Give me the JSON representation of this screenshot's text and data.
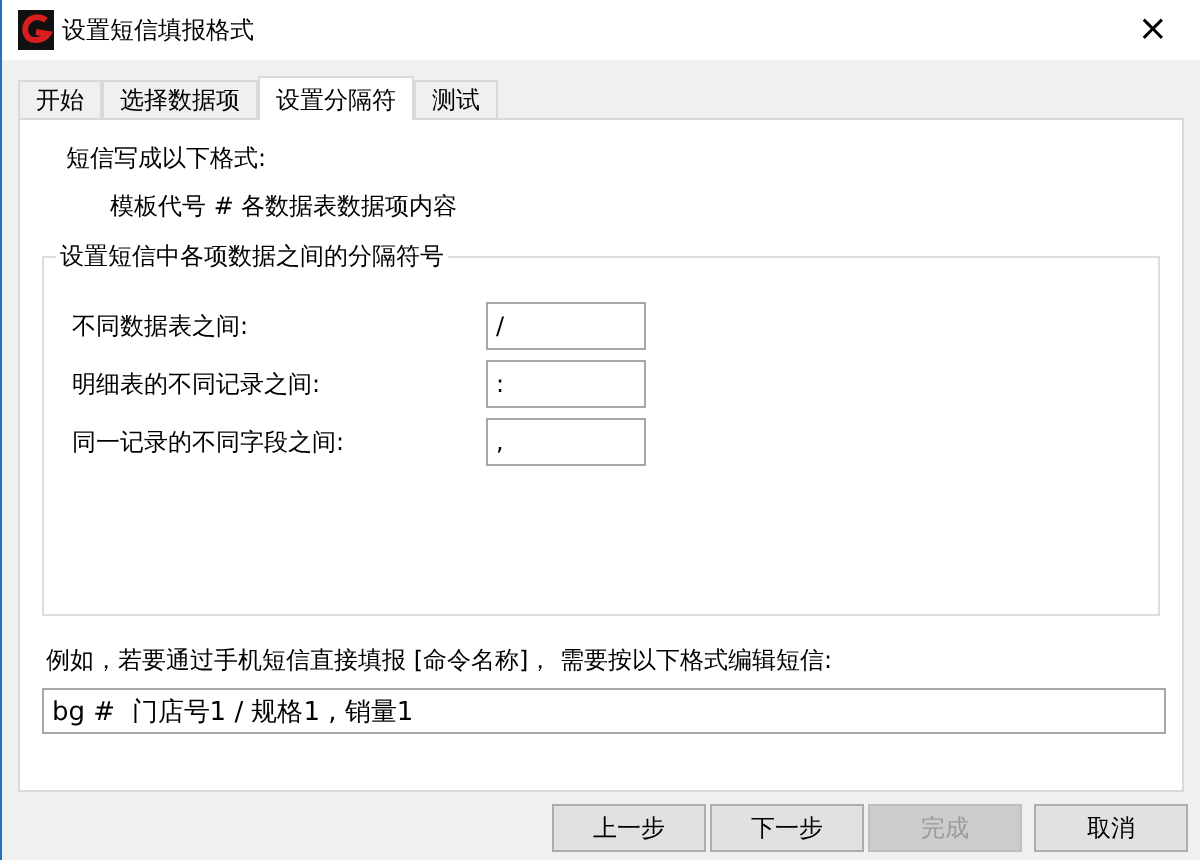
{
  "window": {
    "title": "设置短信填报格式",
    "close": "×"
  },
  "tabs": [
    {
      "label": "开始",
      "selected": false
    },
    {
      "label": "选择数据项",
      "selected": false
    },
    {
      "label": "设置分隔符",
      "selected": true
    },
    {
      "label": "测试",
      "selected": false
    }
  ],
  "format_heading": "短信写成以下格式:",
  "format_pattern": "模板代号 # 各数据表数据项内容",
  "separator_group": {
    "title": "设置短信中各项数据之间的分隔符号",
    "fields": [
      {
        "label": "不同数据表之间:",
        "value": "/"
      },
      {
        "label": "明细表的不同记录之间:",
        "value": ":"
      },
      {
        "label": "同一记录的不同字段之间:",
        "value": ","
      }
    ]
  },
  "example": {
    "label": "例如，若要通过手机短信直接填报 [命令名称]， 需要按以下格式编辑短信:",
    "value": "bg #  门店号1 / 规格1 , 销量1"
  },
  "buttons": [
    {
      "label": "上一步",
      "disabled": false
    },
    {
      "label": "下一步",
      "disabled": false
    },
    {
      "label": "完成",
      "disabled": true
    },
    {
      "label": "取消",
      "disabled": false
    }
  ]
}
